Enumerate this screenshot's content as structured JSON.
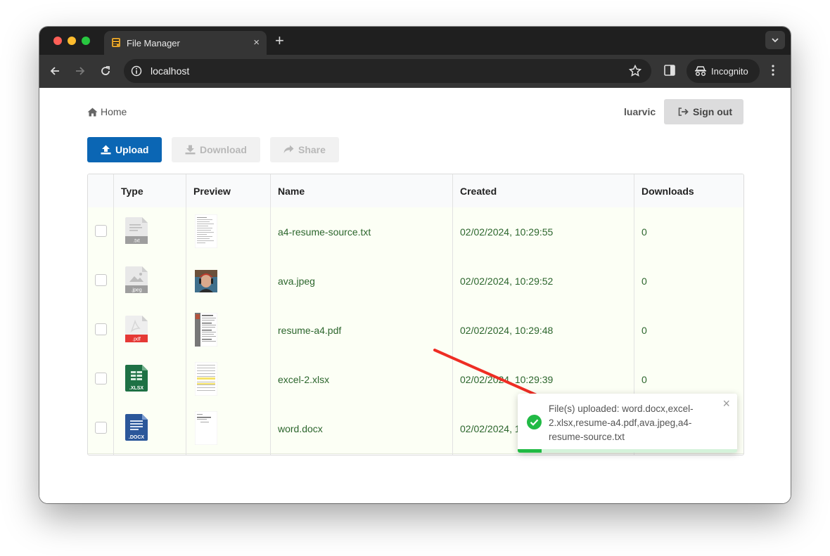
{
  "browser": {
    "tab_title": "File Manager",
    "tab_close": "×",
    "new_tab": "+",
    "url": "localhost",
    "incognito_label": "Incognito"
  },
  "page": {
    "breadcrumb": "Home",
    "username": "luarvic",
    "signout_label": "Sign out",
    "buttons": {
      "upload": "Upload",
      "download": "Download",
      "share": "Share"
    }
  },
  "table": {
    "headers": [
      "",
      "Type",
      "Preview",
      "Name",
      "Created",
      "Downloads"
    ],
    "rows": [
      {
        "type_label": ".txt",
        "icon": "txt-file-icon",
        "name": "a4-resume-source.txt",
        "created": "02/02/2024, 10:29:55",
        "downloads": "0"
      },
      {
        "type_label": ".jpeg",
        "icon": "image-file-icon",
        "name": "ava.jpeg",
        "created": "02/02/2024, 10:29:52",
        "downloads": "0"
      },
      {
        "type_label": ".pdf",
        "icon": "pdf-file-icon",
        "name": "resume-a4.pdf",
        "created": "02/02/2024, 10:29:48",
        "downloads": "0"
      },
      {
        "type_label": ".XLSX",
        "icon": "excel-file-icon",
        "name": "excel-2.xlsx",
        "created": "02/02/2024, 10:29:39",
        "downloads": "0"
      },
      {
        "type_label": ".DOCX",
        "icon": "word-file-icon",
        "name": "word.docx",
        "created": "02/02/2024, 10:29:34",
        "downloads": ""
      }
    ]
  },
  "toast": {
    "message": "File(s) uploaded: word.docx,excel-2.xlsx,resume-a4.pdf,ava.jpeg,a4-resume-source.txt",
    "close": "×",
    "progress": 0.11
  },
  "colors": {
    "primary": "#0b66b4",
    "row_bg": "#fcfff5",
    "cell_text": "#2c662d",
    "success": "#21ba45",
    "annotation_arrow": "#ee2d24"
  }
}
